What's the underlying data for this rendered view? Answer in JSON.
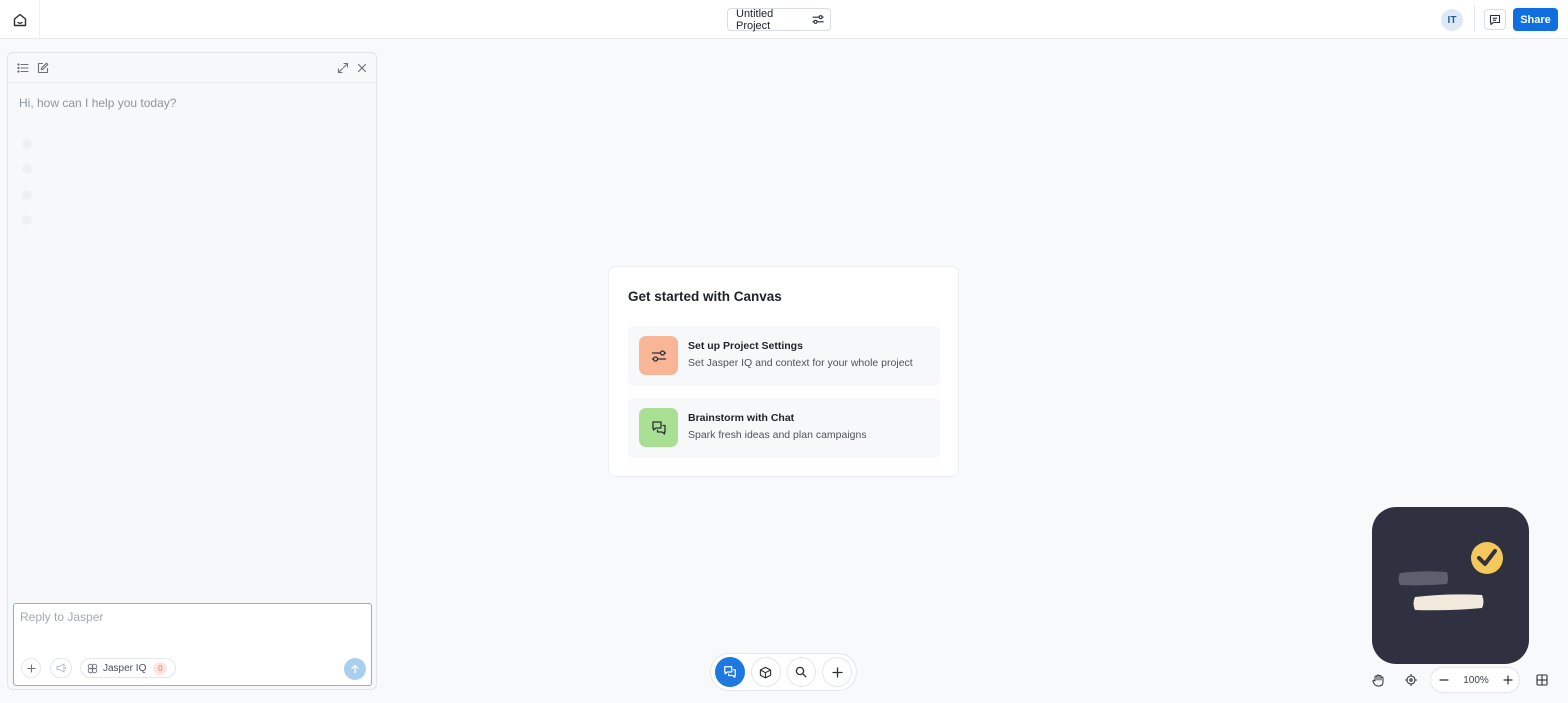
{
  "header": {
    "project_title": "Untitled Project",
    "avatar_initials": "IT",
    "share_label": "Share"
  },
  "chat_panel": {
    "greeting": "Hi, how can I help you today?",
    "reply_placeholder": "Reply to Jasper",
    "jasper_iq_label": "Jasper IQ",
    "jasper_iq_count": "0"
  },
  "start_card": {
    "title": "Get started with Canvas",
    "options": [
      {
        "title": "Set up Project Settings",
        "description": "Set Jasper IQ and context for your whole project",
        "color": "#f9b696"
      },
      {
        "title": "Brainstorm with Chat",
        "description": "Spark fresh ideas and plan campaigns",
        "color": "#a8df93"
      }
    ]
  },
  "zoom": {
    "level": "100%"
  },
  "colors": {
    "accent": "#0f6fde",
    "mascot_bg": "#2f3140",
    "mascot_check": "#f4c85a"
  }
}
